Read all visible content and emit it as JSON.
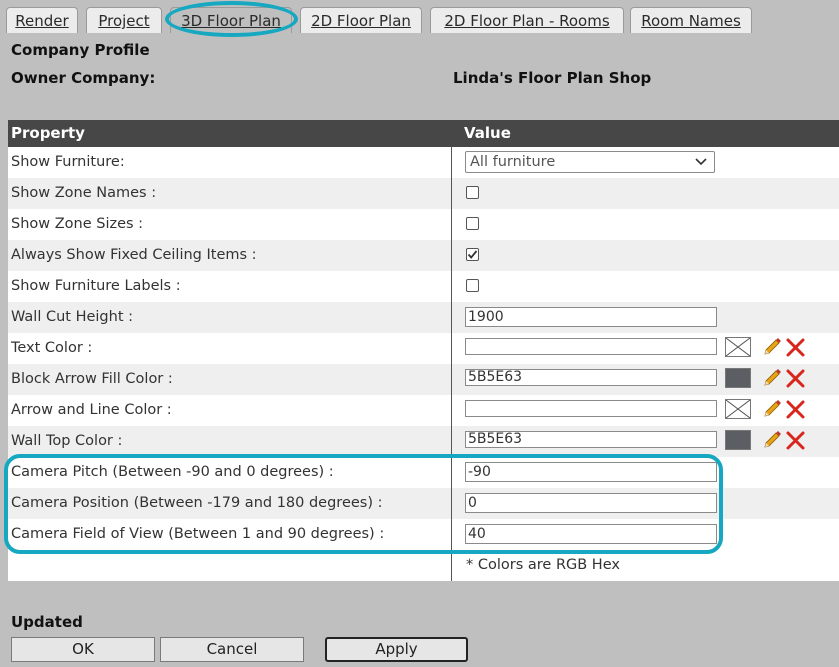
{
  "tabs": [
    {
      "label": "Render"
    },
    {
      "label": "Project"
    },
    {
      "label": "3D Floor Plan"
    },
    {
      "label": "2D Floor Plan"
    },
    {
      "label": "2D Floor Plan - Rooms"
    },
    {
      "label": "Room Names"
    }
  ],
  "active_tab": "3D Floor Plan",
  "profile": {
    "section_title": "Company Profile",
    "owner_label": "Owner Company:",
    "owner_value": "Linda's Floor Plan Shop"
  },
  "grid": {
    "header_property": "Property",
    "header_value": "Value",
    "rows": [
      {
        "label": "Show Furniture:",
        "type": "select",
        "value": "All furniture"
      },
      {
        "label": "Show Zone Names :",
        "type": "checkbox",
        "checked": false
      },
      {
        "label": "Show Zone Sizes :",
        "type": "checkbox",
        "checked": false
      },
      {
        "label": "Always Show Fixed Ceiling Items :",
        "type": "checkbox",
        "checked": true
      },
      {
        "label": "Show Furniture Labels :",
        "type": "checkbox",
        "checked": false
      },
      {
        "label": "Wall Cut Height :",
        "type": "text",
        "value": "1900"
      },
      {
        "label": "Text Color :",
        "type": "color",
        "value": "",
        "swatch": "empty"
      },
      {
        "label": "Block Arrow Fill Color :",
        "type": "color",
        "value": "5B5E63",
        "swatch": "#5B5E63"
      },
      {
        "label": "Arrow and Line Color :",
        "type": "color",
        "value": "",
        "swatch": "empty"
      },
      {
        "label": "Wall Top Color :",
        "type": "color",
        "value": "5B5E63",
        "swatch": "#5B5E63"
      },
      {
        "label": "Camera Pitch (Between -90 and 0 degrees) :",
        "type": "text",
        "value": "-90"
      },
      {
        "label": "Camera Position (Between -179 and 180 degrees) :",
        "type": "text",
        "value": "0"
      },
      {
        "label": "Camera Field of View (Between 1 and 90 degrees) :",
        "type": "text",
        "value": "40"
      }
    ],
    "footnote": "* Colors are RGB Hex"
  },
  "status": "Updated",
  "buttons": {
    "ok": "OK",
    "cancel": "Cancel",
    "apply": "Apply"
  },
  "colors": {
    "highlight": "#15a8c0",
    "header_bg": "#474747",
    "edit_icon": "#e8a317",
    "delete_icon": "#d9261c"
  },
  "icons": {
    "edit": "pencil-icon",
    "clear": "delete-x-icon",
    "dropdown": "chevron-down-icon",
    "empty_color": "no-color-icon"
  }
}
